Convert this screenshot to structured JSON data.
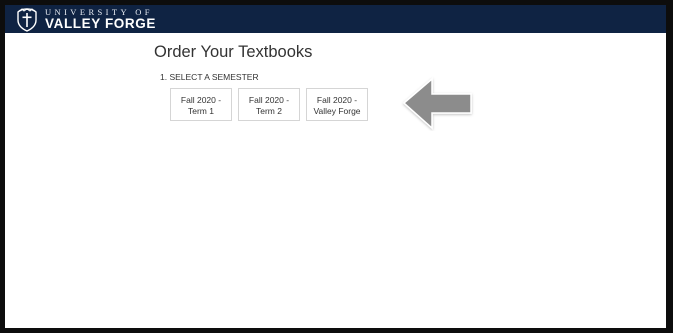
{
  "header": {
    "logo_top": "UNIVERSITY OF",
    "logo_bottom": "VALLEY FORGE",
    "background_color": "#0f2343",
    "logo_icon": "cross-shield-icon"
  },
  "main": {
    "title": "Order Your Textbooks",
    "step_label": "1. SELECT A SEMESTER",
    "semesters": [
      {
        "line1": "Fall 2020 -",
        "line2": "Term 1"
      },
      {
        "line1": "Fall 2020 -",
        "line2": "Term 2"
      },
      {
        "line1": "Fall 2020 -",
        "line2": "Valley Forge"
      }
    ]
  },
  "annotation": {
    "arrow_icon": "arrow-left-icon",
    "arrow_color": "#8c8c8c"
  }
}
